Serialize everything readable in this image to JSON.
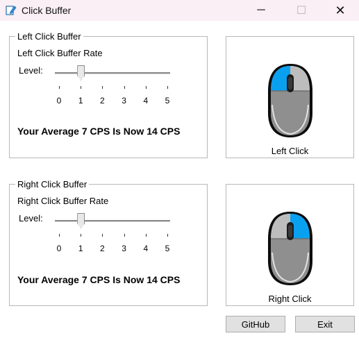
{
  "window": {
    "title": "Click Buffer",
    "minimize_glyph": "─",
    "maximize_glyph": "☐",
    "close_glyph": "✕"
  },
  "left_group": {
    "legend": "Left Click Buffer",
    "rate_label": "Left Click Buffer Rate",
    "level_label": "Level:",
    "slider_value": 1,
    "slider_min": 0,
    "slider_max": 5,
    "tick_labels": [
      "0",
      "1",
      "2",
      "3",
      "4",
      "5"
    ],
    "cps_text": "Your Average 7 CPS Is Now 14 CPS"
  },
  "right_group": {
    "legend": "Right Click Buffer",
    "rate_label": "Right Click Buffer Rate",
    "level_label": "Level:",
    "slider_value": 1,
    "slider_min": 0,
    "slider_max": 5,
    "tick_labels": [
      "0",
      "1",
      "2",
      "3",
      "4",
      "5"
    ],
    "cps_text": "Your Average 7 CPS Is Now 14 CPS"
  },
  "left_mouse": {
    "caption": "Left Click",
    "highlight": "left"
  },
  "right_mouse": {
    "caption": "Right Click",
    "highlight": "right"
  },
  "buttons": {
    "github": "GitHub",
    "exit": "Exit"
  },
  "colors": {
    "highlight": "#0aa0f0",
    "titlebar": "#f9eff4"
  }
}
